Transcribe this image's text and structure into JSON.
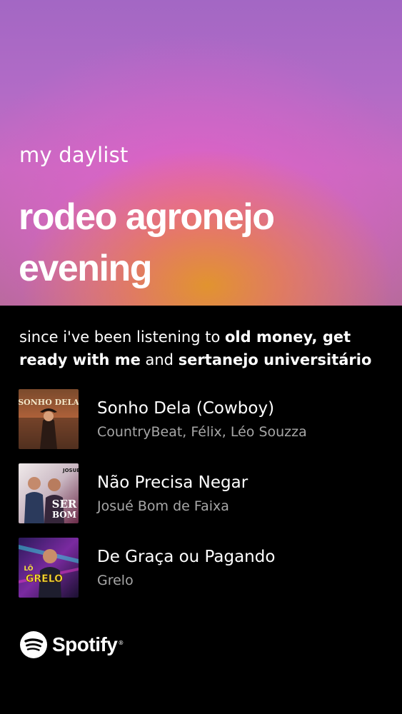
{
  "header": {
    "label": "my daylist",
    "title_line1": "rodeo agronejo",
    "title_line2": "evening"
  },
  "description": {
    "prefix": "since i've been listening to ",
    "bold1": "old money, get ready with me",
    "middle": " and ",
    "bold2": "sertanejo universitário"
  },
  "tracks": [
    {
      "title": "Sonho Dela (Cowboy)",
      "artist": "CountryBeat, Félix, Léo Souzza",
      "cover_text": "SONHO DELA"
    },
    {
      "title": "Não Precisa Negar",
      "artist": "Josué Bom de Faixa",
      "cover_text_top": "JOSUE",
      "cover_text_main": "SER",
      "cover_text_sub": "BOM"
    },
    {
      "title": "De Graça ou Pagando",
      "artist": "Grelo",
      "cover_text": "GRELO",
      "cover_badge": "LÔ"
    }
  ],
  "brand": {
    "name": "Spotify",
    "icon": "spotify-logo-icon",
    "reg_mark": "®"
  },
  "colors": {
    "background": "#000000",
    "text_primary": "#ffffff",
    "text_secondary": "#a7a7a7",
    "hero_purple": "#a367c4",
    "hero_pink": "#ec5cc4",
    "hero_orange": "#e29628"
  }
}
